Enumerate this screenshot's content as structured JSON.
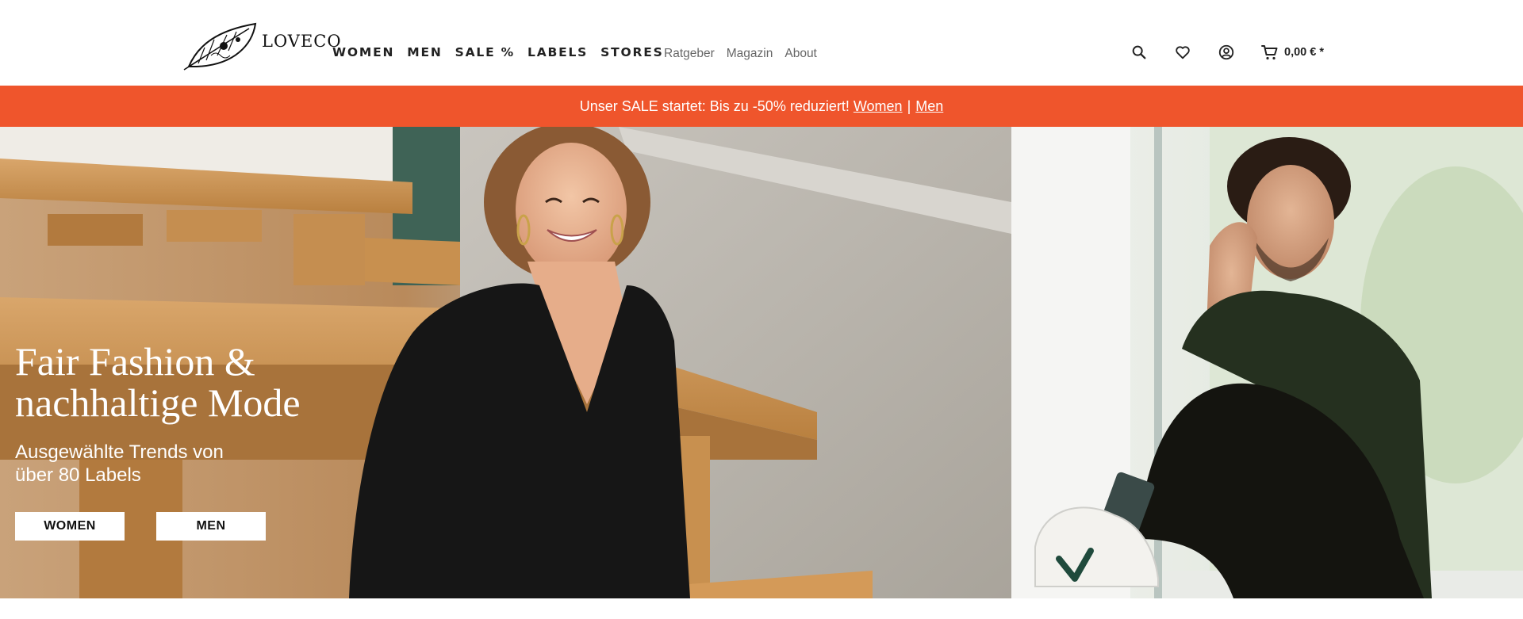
{
  "brand": {
    "name": "LOVECO"
  },
  "main_nav": [
    "WOMEN",
    "MEN",
    "SALE %",
    "LABELS",
    "STORES"
  ],
  "sub_nav": [
    "Ratgeber",
    "Magazin",
    "About"
  ],
  "header": {
    "icons": [
      "search-icon",
      "heart-icon",
      "account-icon",
      "cart-icon"
    ],
    "cart_total": "0,00 € *"
  },
  "banner": {
    "text": "Unser SALE startet: Bis zu -50% reduziert!",
    "link_women": "Women",
    "separator": "|",
    "link_men": "Men",
    "color": "#ef552c"
  },
  "hero": {
    "title_line1": "Fair Fashion &",
    "title_line2": "nachhaltige Mode",
    "subtitle_line1": "Ausgewählte Trends von",
    "subtitle_line2": "über 80 Labels",
    "button_women": "WOMEN",
    "button_men": "MEN"
  }
}
